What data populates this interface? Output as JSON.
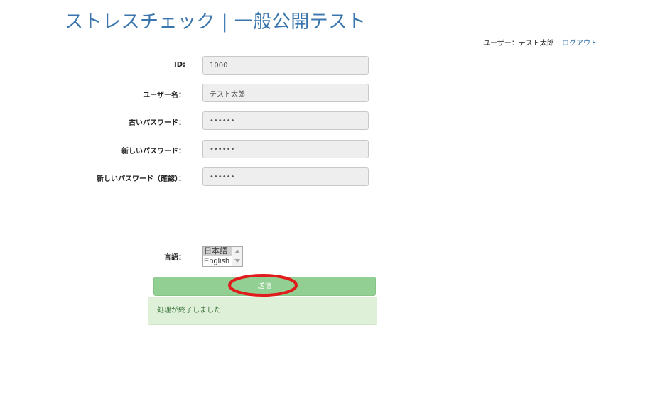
{
  "header": {
    "title": "ストレスチェック | 一般公開テスト",
    "user_label": "ユーザー：テスト太郎",
    "logout_label": "ログアウト"
  },
  "form": {
    "id": {
      "label": "ID:",
      "value": "1000"
    },
    "username": {
      "label": "ユーザー名：",
      "value": "テスト太郎"
    },
    "old_password": {
      "label": "古いパスワード：",
      "value": "••••••"
    },
    "new_password": {
      "label": "新しいパスワード：",
      "value": "••••••"
    },
    "confirm_password": {
      "label": "新しいパスワード（確認）：",
      "value": "••••••"
    },
    "language": {
      "label": "言語：",
      "options": [
        "日本語",
        "English"
      ],
      "selected": "日本語"
    },
    "submit_label": "送信"
  },
  "alert": {
    "message": "処理が終了しました"
  },
  "colors": {
    "title": "#3a76ad",
    "link": "#2f6fa8",
    "submit_bg": "#92cf92",
    "alert_bg": "#dff0d8",
    "alert_text": "#3c763d",
    "highlight": "#e01b1b"
  }
}
